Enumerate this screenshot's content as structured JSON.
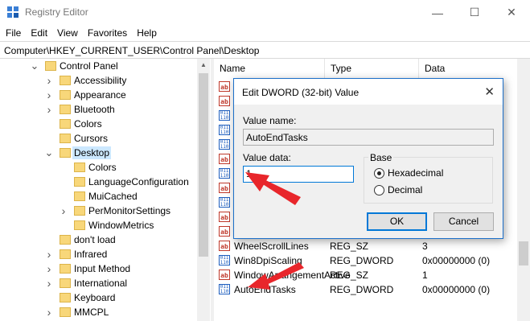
{
  "window": {
    "title": "Registry Editor",
    "minimize": "—",
    "maximize": "☐",
    "close": "✕"
  },
  "menu": [
    "File",
    "Edit",
    "View",
    "Favorites",
    "Help"
  ],
  "address": "Computer\\HKEY_CURRENT_USER\\Control Panel\\Desktop",
  "tree": [
    {
      "label": "Control Panel",
      "expanded": true,
      "indent": 0
    },
    {
      "label": "Accessibility",
      "expanded": false,
      "indent": 1
    },
    {
      "label": "Appearance",
      "expanded": false,
      "indent": 1
    },
    {
      "label": "Bluetooth",
      "expanded": false,
      "indent": 1
    },
    {
      "label": "Colors",
      "expanded": null,
      "indent": 1
    },
    {
      "label": "Cursors",
      "expanded": null,
      "indent": 1
    },
    {
      "label": "Desktop",
      "expanded": true,
      "indent": 1,
      "selected": true
    },
    {
      "label": "Colors",
      "expanded": null,
      "indent": 2
    },
    {
      "label": "LanguageConfiguration",
      "expanded": null,
      "indent": 2
    },
    {
      "label": "MuiCached",
      "expanded": null,
      "indent": 2
    },
    {
      "label": "PerMonitorSettings",
      "expanded": false,
      "indent": 2
    },
    {
      "label": "WindowMetrics",
      "expanded": null,
      "indent": 2
    },
    {
      "label": "don't load",
      "expanded": null,
      "indent": 1
    },
    {
      "label": "Infrared",
      "expanded": false,
      "indent": 1
    },
    {
      "label": "Input Method",
      "expanded": false,
      "indent": 1
    },
    {
      "label": "International",
      "expanded": false,
      "indent": 1
    },
    {
      "label": "Keyboard",
      "expanded": null,
      "indent": 1
    },
    {
      "label": "MMCPL",
      "expanded": false,
      "indent": 1
    }
  ],
  "list": {
    "headers": [
      "Name",
      "Type",
      "Data"
    ],
    "rows": [
      {
        "icon": "string-value-icon",
        "name": "",
        "type": "",
        "data": ""
      },
      {
        "icon": "string-value-icon",
        "name": "",
        "type": "",
        "data": ""
      },
      {
        "icon": "dword-value-icon",
        "name": "",
        "type": "",
        "data": "1 00"
      },
      {
        "icon": "dword-value-icon",
        "name": "",
        "type": "",
        "data": ""
      },
      {
        "icon": "dword-value-icon",
        "name": "",
        "type": "",
        "data": "0 00"
      },
      {
        "icon": "string-value-icon",
        "name": "",
        "type": "",
        "data": "vall"
      },
      {
        "icon": "dword-value-icon",
        "name": "",
        "type": "",
        "data": ""
      },
      {
        "icon": "string-value-icon",
        "name": "",
        "type": "",
        "data": ""
      },
      {
        "icon": "dword-value-icon",
        "name": "",
        "type": "",
        "data": ""
      },
      {
        "icon": "string-value-icon",
        "name": "",
        "type": "",
        "data": ""
      },
      {
        "icon": "string-value-icon",
        "name": "",
        "type": "",
        "data": ""
      },
      {
        "icon": "string-value-icon",
        "name": "WheelScrollLines",
        "type": "REG_SZ",
        "data": "3"
      },
      {
        "icon": "dword-value-icon",
        "name": "Win8DpiScaling",
        "type": "REG_DWORD",
        "data": "0x00000000 (0)"
      },
      {
        "icon": "string-value-icon",
        "name": "WindowArrangementActive",
        "type": "REG_SZ",
        "data": "1"
      },
      {
        "icon": "dword-value-icon",
        "name": "AutoEndTasks",
        "type": "REG_DWORD",
        "data": "0x00000000 (0)"
      }
    ]
  },
  "dialog": {
    "title": "Edit DWORD (32-bit) Value",
    "close": "✕",
    "value_name_label": "Value name:",
    "value_name": "AutoEndTasks",
    "value_data_label": "Value data:",
    "value_data": "1",
    "base_label": "Base",
    "hex_label": "Hexadecimal",
    "dec_label": "Decimal",
    "base_selected": "Hexadecimal",
    "ok_label": "OK",
    "cancel_label": "Cancel"
  },
  "icons": {
    "string": "ab",
    "binary": "011\n110"
  },
  "colors": {
    "annotation_arrow": "#e8262b",
    "accent": "#0078d7",
    "selection": "#cce8ff"
  }
}
